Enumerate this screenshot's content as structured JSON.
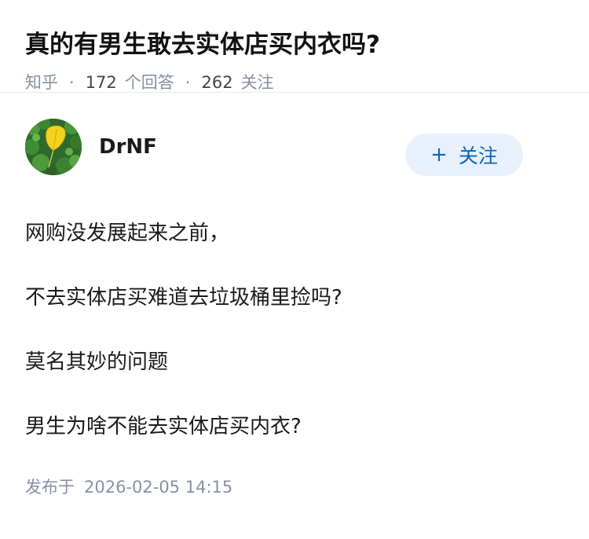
{
  "question": {
    "title": "真的有男生敢去实体店买内衣吗?",
    "source": "知乎",
    "separator": "·",
    "answer_count": "172",
    "answer_label": "个回答",
    "follower_count": "262",
    "follower_label": "关注"
  },
  "answer": {
    "author_name": "DrNF",
    "avatar_icon": "ginkgo-leaf-avatar",
    "follow_label": "关注",
    "follow_icon": "plus-icon",
    "paragraphs": [
      "网购没发展起来之前，",
      "不去实体店买难道去垃圾桶里捡吗?",
      "莫名其妙的问题",
      "男生为啥不能去实体店买内衣?"
    ],
    "published_label": "发布于",
    "published_time": "2026-02-05 14:15"
  },
  "colors": {
    "accent": "#0a66c2",
    "button_bg": "#e8f0fb",
    "muted": "#8590a6"
  }
}
